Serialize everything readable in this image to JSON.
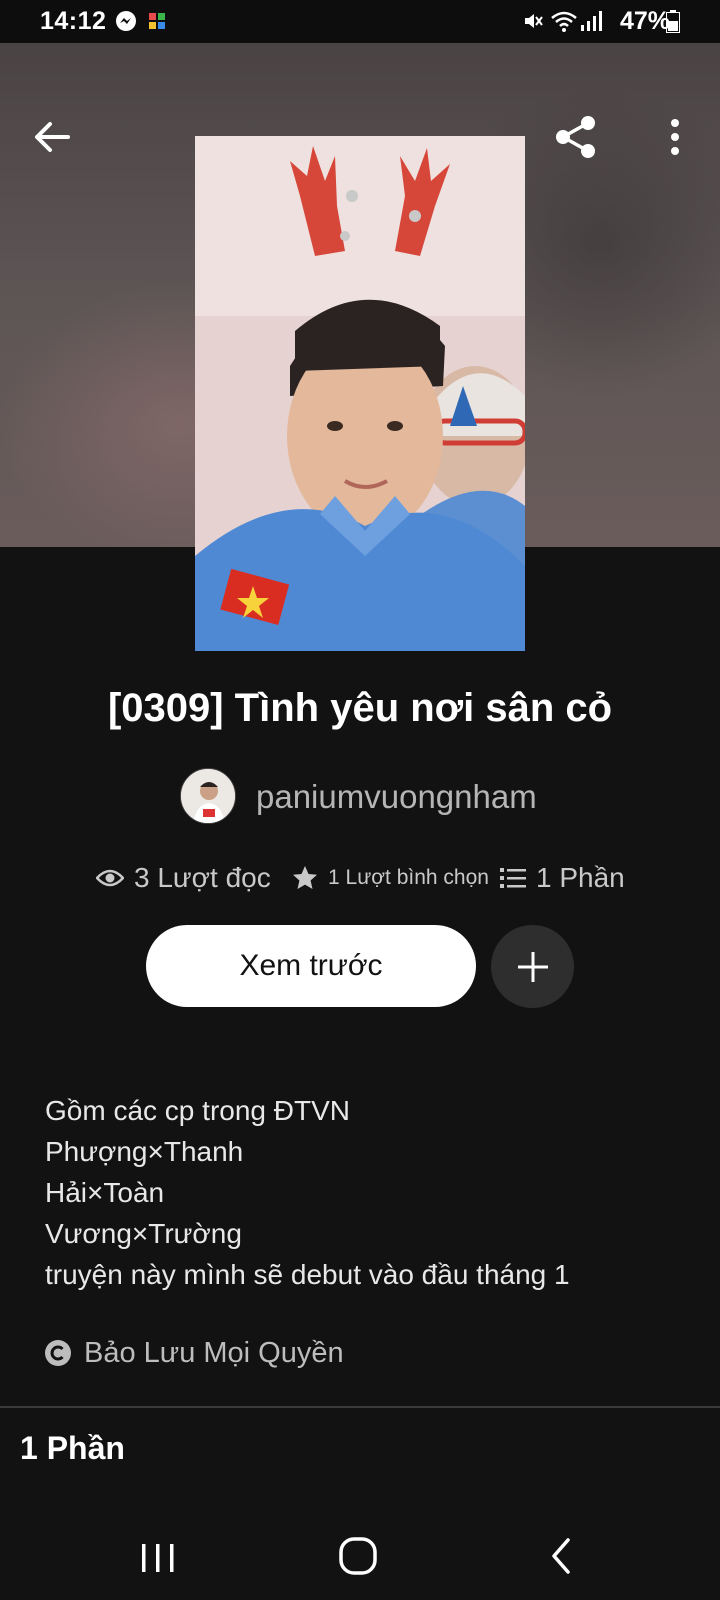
{
  "status_bar": {
    "time": "14:12",
    "battery": "47%"
  },
  "header": {
    "back_icon": "arrow-left-icon",
    "share_icon": "share-icon",
    "more_icon": "more-vertical-icon"
  },
  "story": {
    "title": "[0309] Tình yêu nơi sân cỏ",
    "author": "paniumvuongnham",
    "stats": {
      "reads": "3 Lượt đọc",
      "votes": "1 Lượt bình chọn",
      "parts": "1 Phần"
    },
    "preview_button": "Xem trước",
    "description_lines": [
      "Gồm các cp trong ĐTVN",
      "Phượng×Thanh",
      "Hải×Toàn",
      "Vương×Trường",
      "truyện này mình sẽ debut vào đầu tháng 1"
    ],
    "copyright": "Bảo Lưu Mọi Quyền",
    "parts_heading": "1 Phần"
  },
  "colors": {
    "background": "#121212",
    "button_bg": "#ffffff",
    "add_button_bg": "#2e2e2e",
    "muted_text": "#b5b5b5"
  }
}
